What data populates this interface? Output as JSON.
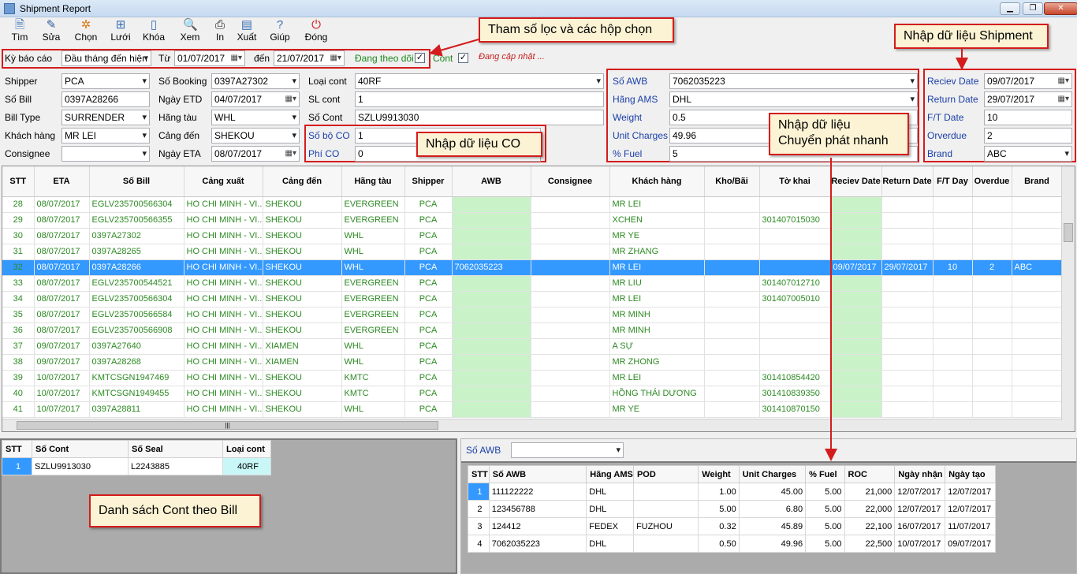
{
  "window": {
    "title": "Shipment Report"
  },
  "toolbar": [
    {
      "label": "Tìm",
      "icon": "find-icon",
      "glyph": "🗎",
      "color": "#3a6fb3"
    },
    {
      "label": "Sửa",
      "icon": "edit-pencil-icon",
      "glyph": "✎",
      "color": "#2a5c9c"
    },
    {
      "label": "Chọn",
      "icon": "gear-select-icon",
      "glyph": "✲",
      "color": "#e07a14"
    },
    {
      "label": "Lưới",
      "icon": "grid-icon",
      "glyph": "⊞",
      "color": "#3a6fb3"
    },
    {
      "label": "Khóa",
      "icon": "lock-icon",
      "glyph": "▯",
      "color": "#3a6fb3"
    },
    {
      "label": "Xem",
      "icon": "preview-icon",
      "glyph": "🔍",
      "color": "#3a6fb3"
    },
    {
      "label": "In",
      "icon": "printer-icon",
      "glyph": "⎙",
      "color": "#111111"
    },
    {
      "label": "Xuất",
      "icon": "export-icon",
      "glyph": "▤",
      "color": "#3a6fb3"
    },
    {
      "label": "Giúp",
      "icon": "help-icon",
      "glyph": "?",
      "color": "#3a6fb3"
    },
    {
      "label": "Đóng",
      "icon": "power-icon",
      "glyph": "⏻",
      "color": "#d41c1c"
    }
  ],
  "filter": {
    "period_label": "Kỳ báo cáo",
    "period_value": "Đầu tháng đến hiện",
    "from_label": "Từ",
    "from_value": "01/07/2017",
    "to_label": "đến",
    "to_value": "21/07/2017",
    "tracking_label": "Đang theo dõi",
    "cont_label": "Cont",
    "status": "Đang cập nhật ..."
  },
  "callouts": {
    "filter": "Tham số lọc và các hộp chọn",
    "shipment": "Nhập dữ liệu Shipment",
    "co": "Nhập dữ liệu CO",
    "express_1": "Nhập dữ liệu",
    "express_2": "Chuyển phát nhanh",
    "cont_list": "Danh sách Cont theo Bill"
  },
  "form": {
    "shipper_label": "Shipper",
    "shipper": "PCA",
    "bill_label": "Số Bill",
    "bill": "0397A28266",
    "billtype_label": "Bill Type",
    "billtype": "SURRENDER",
    "customer_label": "Khách hàng",
    "customer": "MR LEI",
    "consignee_label": "Consignee",
    "consignee": "",
    "booking_label": "Số Booking",
    "booking": "0397A27302",
    "etd_label": "Ngày ETD",
    "etd": "04/07/2017",
    "carrier_label": "Hãng tàu",
    "carrier": "WHL",
    "port_label": "Cảng đến",
    "port": "SHEKOU",
    "eta_label": "Ngày ETA",
    "eta": "08/07/2017",
    "conttype_label": "Loại cont",
    "conttype": "40RF",
    "slcont_label": "SL cont",
    "slcont": "1",
    "socont_label": "Số Cont",
    "socont": "SZLU9913030",
    "boco_label": "Số bộ CO",
    "boco": "1",
    "phico_label": "Phí CO",
    "phico": "0",
    "awb_label": "Số AWB",
    "awb": "7062035223",
    "ams_label": "Hãng AMS",
    "ams": "DHL",
    "weight_label": "Weight",
    "weight": "0.5",
    "unit_label": "Unit Charges",
    "unit": "49.96",
    "fuel_label": "% Fuel",
    "fuel": "5",
    "recv_label": "Reciev Date",
    "recv": "09/07/2017",
    "return_label": "Return Date",
    "ret": "29/07/2017",
    "ft_label": "F/T Date",
    "ft": "10",
    "overdue_label": "Orverdue",
    "overdue": "2",
    "brand_label": "Brand",
    "brand": "ABC"
  },
  "grid": {
    "headers": [
      "STT",
      "ETA",
      "Số Bill",
      "Cảng xuất",
      "Cảng đến",
      "Hãng tàu",
      "Shipper",
      "AWB",
      "Consignee",
      "Khách hàng",
      "Kho/Bãi",
      "Tờ khai",
      "Reciev Date",
      "Return Date",
      "F/T Day",
      "Overdue",
      "Brand"
    ],
    "rows": [
      [
        "28",
        "08/07/2017",
        "EGLV235700566304",
        "HO CHI MINH - VI...",
        "SHEKOU",
        "EVERGREEN",
        "PCA",
        "",
        "",
        "MR LEI",
        "",
        "",
        "",
        "",
        "",
        "",
        ""
      ],
      [
        "29",
        "08/07/2017",
        "EGLV235700566355",
        "HO CHI MINH - VI...",
        "SHEKOU",
        "EVERGREEN",
        "PCA",
        "",
        "",
        "XCHEN",
        "",
        "301407015030",
        "",
        "",
        "",
        "",
        ""
      ],
      [
        "30",
        "08/07/2017",
        "0397A27302",
        "HO CHI MINH - VI...",
        "SHEKOU",
        "WHL",
        "PCA",
        "",
        "",
        "MR YE",
        "",
        "",
        "",
        "",
        "",
        "",
        ""
      ],
      [
        "31",
        "08/07/2017",
        "0397A28265",
        "HO CHI MINH - VI...",
        "SHEKOU",
        "WHL",
        "PCA",
        "",
        "",
        "MR ZHANG",
        "",
        "",
        "",
        "",
        "",
        "",
        ""
      ],
      [
        "32",
        "08/07/2017",
        "0397A28266",
        "HO CHI MINH - VI...",
        "SHEKOU",
        "WHL",
        "PCA",
        "7062035223",
        "",
        "MR LEI",
        "",
        "",
        "09/07/2017",
        "29/07/2017",
        "10",
        "2",
        "ABC"
      ],
      [
        "33",
        "08/07/2017",
        "EGLV235700544521",
        "HO CHI MINH - VI...",
        "SHEKOU",
        "EVERGREEN",
        "PCA",
        "",
        "",
        "MR LIU",
        "",
        "301407012710",
        "",
        "",
        "",
        "",
        ""
      ],
      [
        "34",
        "08/07/2017",
        "EGLV235700566304",
        "HO CHI MINH - VI...",
        "SHEKOU",
        "EVERGREEN",
        "PCA",
        "",
        "",
        "MR LEI",
        "",
        "301407005010",
        "",
        "",
        "",
        "",
        ""
      ],
      [
        "35",
        "08/07/2017",
        "EGLV235700566584",
        "HO CHI MINH - VI...",
        "SHEKOU",
        "EVERGREEN",
        "PCA",
        "",
        "",
        "MR MINH",
        "",
        "",
        "",
        "",
        "",
        "",
        ""
      ],
      [
        "36",
        "08/07/2017",
        "EGLV235700566908",
        "HO CHI MINH - VI...",
        "SHEKOU",
        "EVERGREEN",
        "PCA",
        "",
        "",
        "MR MINH",
        "",
        "",
        "",
        "",
        "",
        "",
        ""
      ],
      [
        "37",
        "09/07/2017",
        "0397A27640",
        "HO CHI MINH - VI...",
        "XIAMEN",
        "WHL",
        "PCA",
        "",
        "",
        "A SỰ",
        "",
        "",
        "",
        "",
        "",
        "",
        ""
      ],
      [
        "38",
        "09/07/2017",
        "0397A28268",
        "HO CHI MINH - VI...",
        "XIAMEN",
        "WHL",
        "PCA",
        "",
        "",
        "MR ZHONG",
        "",
        "",
        "",
        "",
        "",
        "",
        ""
      ],
      [
        "39",
        "10/07/2017",
        "KMTCSGN1947469",
        "HO CHI MINH - VI...",
        "SHEKOU",
        "KMTC",
        "PCA",
        "",
        "",
        "MR LEI",
        "",
        "301410854420",
        "",
        "",
        "",
        "",
        ""
      ],
      [
        "40",
        "10/07/2017",
        "KMTCSGN1949455",
        "HO CHI MINH - VI...",
        "SHEKOU",
        "KMTC",
        "PCA",
        "",
        "",
        "HỒNG THÁI DƯƠNG",
        "",
        "301410839350",
        "",
        "",
        "",
        "",
        ""
      ],
      [
        "41",
        "10/07/2017",
        "0397A28811",
        "HO CHI MINH - VI...",
        "SHEKOU",
        "WHL",
        "PCA",
        "",
        "",
        "MR YE",
        "",
        "301410870150",
        "",
        "",
        "",
        "",
        ""
      ]
    ]
  },
  "cont_table": {
    "headers": [
      "STT",
      "Số Cont",
      "Số Seal",
      "Loại cont"
    ],
    "rows": [
      [
        "1",
        "SZLU9913030",
        "L2243885",
        "40RF"
      ]
    ]
  },
  "awb_panel": {
    "label": "Số AWB",
    "value": "",
    "headers": [
      "STT",
      "Số AWB",
      "Hãng AMS",
      "POD",
      "Weight",
      "Unit Charges",
      "% Fuel",
      "ROC",
      "Ngày nhận",
      "Ngày tạo"
    ],
    "rows": [
      [
        "1",
        "111122222",
        "DHL",
        "",
        "1.00",
        "45.00",
        "5.00",
        "21,000",
        "12/07/2017",
        "12/07/2017"
      ],
      [
        "2",
        "123456788",
        "DHL",
        "",
        "5.00",
        "6.80",
        "5.00",
        "22,000",
        "12/07/2017",
        "12/07/2017"
      ],
      [
        "3",
        "124412",
        "FEDEX",
        "FUZHOU",
        "0.32",
        "45.89",
        "5.00",
        "22,100",
        "16/07/2017",
        "11/07/2017"
      ],
      [
        "4",
        "7062035223",
        "DHL",
        "",
        "0.50",
        "49.96",
        "5.00",
        "22,500",
        "10/07/2017",
        "09/07/2017"
      ]
    ]
  }
}
